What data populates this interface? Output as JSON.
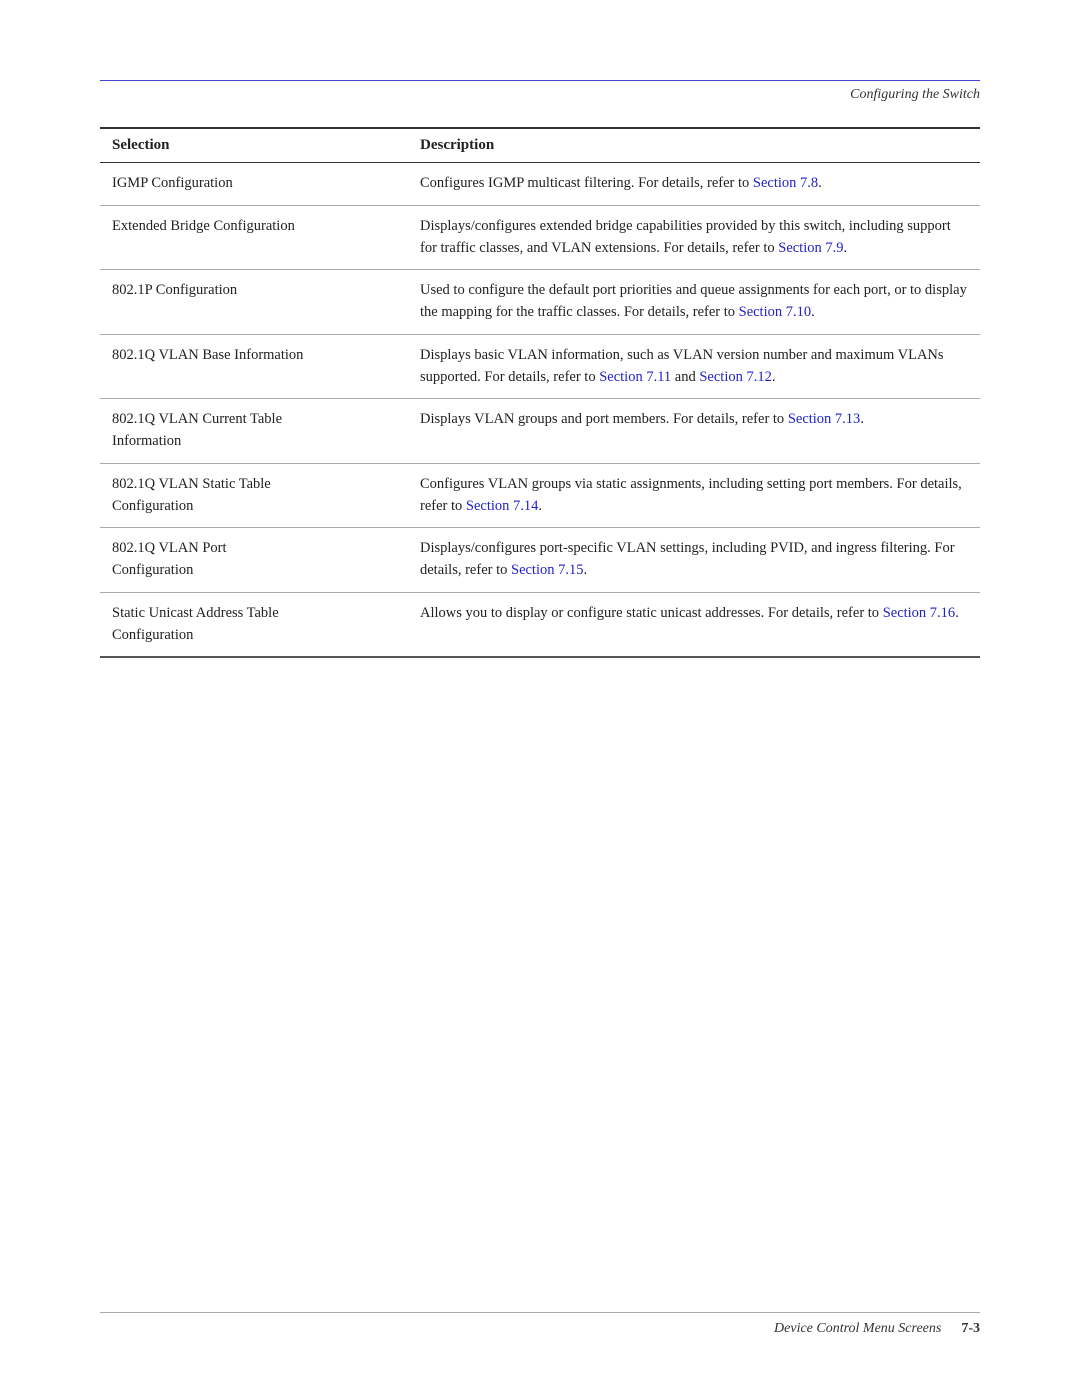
{
  "header": {
    "title": "Configuring the Switch",
    "rule_color": "#4444cc"
  },
  "table": {
    "col1_header": "Selection",
    "col2_header": "Description",
    "rows": [
      {
        "selection": "IGMP Configuration",
        "description_parts": [
          {
            "text": "Configures IGMP multicast filtering. For details, refer to ",
            "type": "text"
          },
          {
            "text": "Section 7.8",
            "type": "link",
            "href": "#section7.8"
          },
          {
            "text": ".",
            "type": "text"
          }
        ]
      },
      {
        "selection": "Extended Bridge Configuration",
        "description_parts": [
          {
            "text": "Displays/configures extended bridge capabilities provided by this switch, including support for traffic classes, and VLAN extensions. For details, refer to ",
            "type": "text"
          },
          {
            "text": "Section 7.9",
            "type": "link",
            "href": "#section7.9"
          },
          {
            "text": ".",
            "type": "text"
          }
        ]
      },
      {
        "selection": "802.1P Configuration",
        "description_parts": [
          {
            "text": "Used to configure the default port priorities and queue assignments for each port, or to display the mapping for the traffic classes. For details, refer to ",
            "type": "text"
          },
          {
            "text": "Section 7.10",
            "type": "link",
            "href": "#section7.10"
          },
          {
            "text": ".",
            "type": "text"
          }
        ]
      },
      {
        "selection": "802.1Q VLAN Base Information",
        "description_parts": [
          {
            "text": "Displays basic VLAN information, such as VLAN version number and maximum VLANs supported. For details, refer to ",
            "type": "text"
          },
          {
            "text": "Section 7.11",
            "type": "link",
            "href": "#section7.11"
          },
          {
            "text": " and ",
            "type": "text"
          },
          {
            "text": "Section 7.12",
            "type": "link",
            "href": "#section7.12"
          },
          {
            "text": ".",
            "type": "text"
          }
        ]
      },
      {
        "selection": "802.1Q VLAN Current Table\nInformation",
        "description_parts": [
          {
            "text": "Displays VLAN groups and port members. For details, refer to ",
            "type": "text"
          },
          {
            "text": "Section 7.13",
            "type": "link",
            "href": "#section7.13"
          },
          {
            "text": ".",
            "type": "text"
          }
        ]
      },
      {
        "selection": "802.1Q VLAN Static Table\nConfiguration",
        "description_parts": [
          {
            "text": "Configures VLAN groups via static assignments, including setting port members. For details, refer to ",
            "type": "text"
          },
          {
            "text": "Section 7.14",
            "type": "link",
            "href": "#section7.14"
          },
          {
            "text": ".",
            "type": "text"
          }
        ]
      },
      {
        "selection": "802.1Q VLAN Port\nConfiguration",
        "description_parts": [
          {
            "text": "Displays/configures port-specific VLAN settings, including PVID, and ingress filtering. For details, refer to ",
            "type": "text"
          },
          {
            "text": "Section 7.15",
            "type": "link",
            "href": "#section7.15"
          },
          {
            "text": ".",
            "type": "text"
          }
        ]
      },
      {
        "selection": "Static Unicast Address Table\nConfiguration",
        "description_parts": [
          {
            "text": "Allows you to display or configure static unicast addresses. For details, refer to ",
            "type": "text"
          },
          {
            "text": "Section 7.16",
            "type": "link",
            "href": "#section7.16"
          },
          {
            "text": ".",
            "type": "text"
          }
        ]
      }
    ]
  },
  "footer": {
    "text": "Device Control Menu Screens",
    "page": "7-3"
  }
}
